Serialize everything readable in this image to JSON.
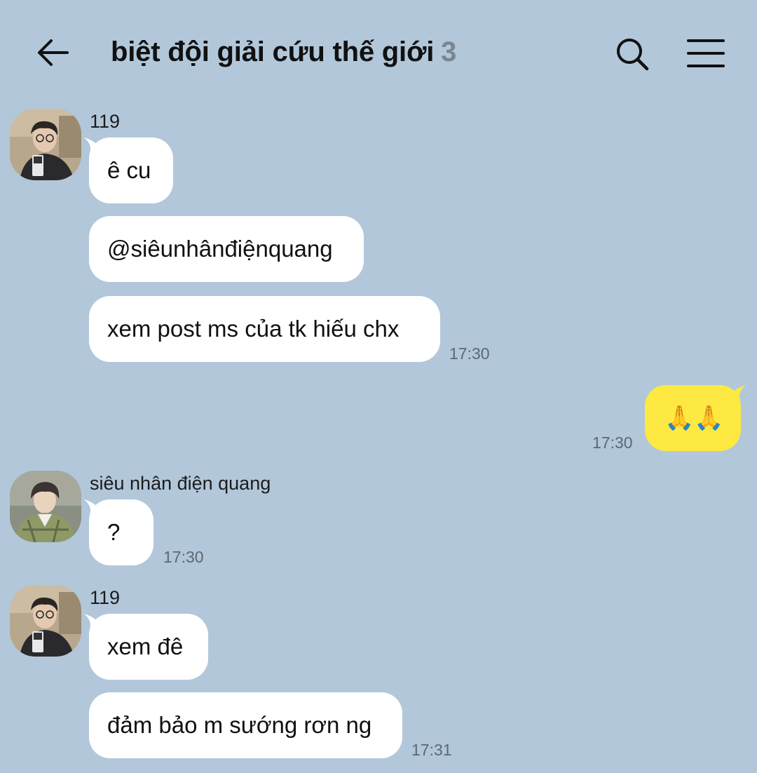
{
  "header": {
    "title": "biệt đội giải cứu thế giới",
    "member_count": "3"
  },
  "messages": [
    {
      "sender": "119",
      "bubbles": [
        "ê cu",
        "@siêunhânđiệnquang",
        "xem post ms của tk hiếu chx"
      ],
      "time": "17:30"
    },
    {
      "sender": "me",
      "bubbles": [
        "🙏🙏"
      ],
      "time": "17:30"
    },
    {
      "sender": "siêu nhân điện quang",
      "bubbles": [
        "?"
      ],
      "time": "17:30"
    },
    {
      "sender": "119",
      "bubbles": [
        "xem đê",
        "đảm bảo m sướng rơn ng"
      ],
      "time": "17:31"
    }
  ],
  "colors": {
    "background": "#b2c7da",
    "incoming_bubble": "#ffffff",
    "outgoing_bubble": "#fee942",
    "timestamp": "#5d6872",
    "member_count": "#7c8690"
  },
  "icons": {
    "back": "arrow-left-icon",
    "search": "search-icon",
    "menu": "hamburger-menu-icon"
  }
}
